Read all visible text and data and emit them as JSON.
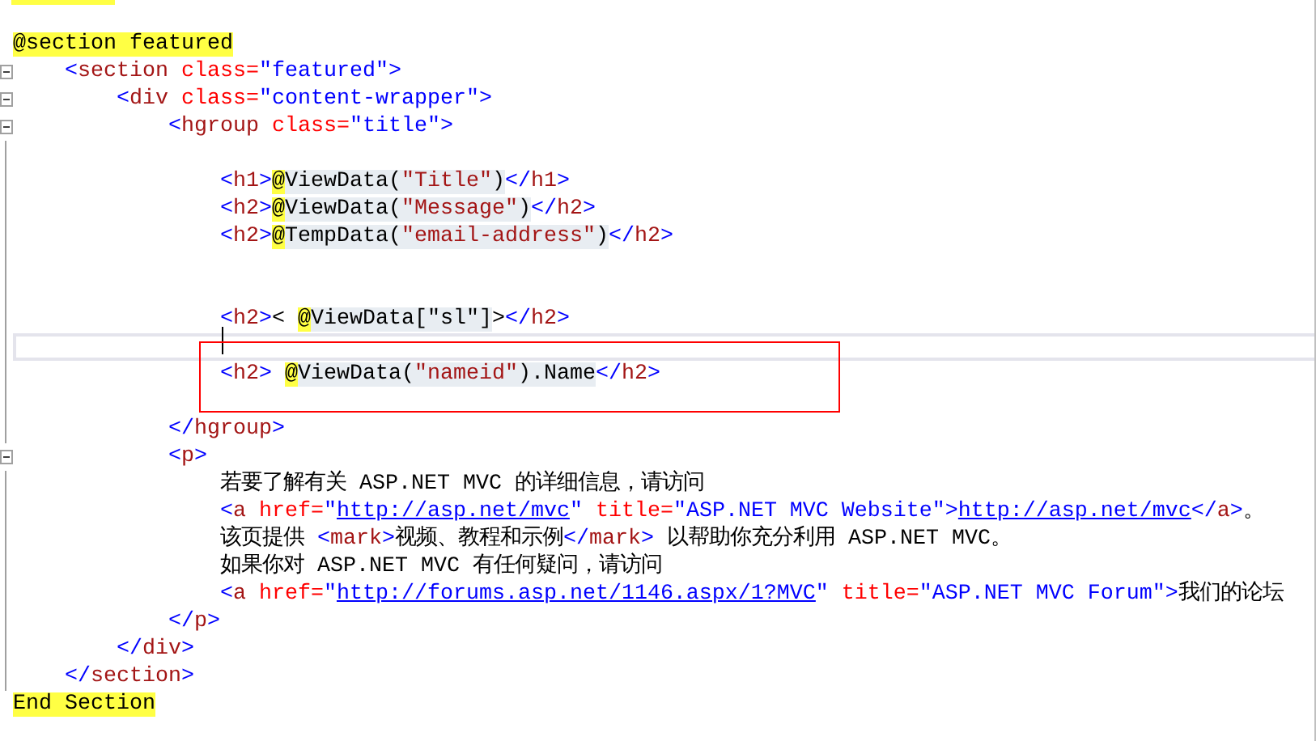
{
  "lines": [
    {
      "foldable": false,
      "nested": false,
      "current": false,
      "tokens": [
        {
          "kind": "directive",
          "text": "@section featured"
        }
      ]
    },
    {
      "foldable": true,
      "nested": true,
      "current": false,
      "tokens": [
        {
          "kind": "tag",
          "text": "    <"
        },
        {
          "kind": "name",
          "text": "section"
        },
        {
          "kind": "attr",
          "text": " class="
        },
        {
          "kind": "value",
          "text": "\"featured\""
        },
        {
          "kind": "tag",
          "text": ">"
        }
      ]
    },
    {
      "foldable": true,
      "nested": true,
      "current": false,
      "tokens": [
        {
          "kind": "tag",
          "text": "        <"
        },
        {
          "kind": "name",
          "text": "div"
        },
        {
          "kind": "attr",
          "text": " class="
        },
        {
          "kind": "value",
          "text": "\"content-wrapper\""
        },
        {
          "kind": "tag",
          "text": ">"
        }
      ]
    },
    {
      "foldable": true,
      "nested": true,
      "current": false,
      "tokens": [
        {
          "kind": "tag",
          "text": "            <"
        },
        {
          "kind": "name",
          "text": "hgroup"
        },
        {
          "kind": "attr",
          "text": " class="
        },
        {
          "kind": "value",
          "text": "\"title\""
        },
        {
          "kind": "tag",
          "text": ">"
        }
      ]
    },
    {
      "foldable": false,
      "nested": true,
      "current": false
    },
    {
      "foldable": false,
      "nested": true,
      "current": false,
      "tokens": [
        {
          "kind": "tag",
          "text": "                <"
        },
        {
          "kind": "name",
          "text": "h1"
        },
        {
          "kind": "tag",
          "text": ">"
        },
        {
          "kind": "at",
          "text": "@"
        },
        {
          "kind": "razor",
          "text": "ViewData("
        },
        {
          "kind": "rstring",
          "text": "\"Title\""
        },
        {
          "kind": "razor",
          "text": ")"
        },
        {
          "kind": "tag",
          "text": "</"
        },
        {
          "kind": "name",
          "text": "h1"
        },
        {
          "kind": "tag",
          "text": ">"
        }
      ]
    },
    {
      "foldable": false,
      "nested": true,
      "current": false,
      "tokens": [
        {
          "kind": "tag",
          "text": "                <"
        },
        {
          "kind": "name",
          "text": "h2"
        },
        {
          "kind": "tag",
          "text": ">"
        },
        {
          "kind": "at",
          "text": "@"
        },
        {
          "kind": "razor",
          "text": "ViewData("
        },
        {
          "kind": "rstring",
          "text": "\"Message\""
        },
        {
          "kind": "razor",
          "text": ")"
        },
        {
          "kind": "tag",
          "text": "</"
        },
        {
          "kind": "name",
          "text": "h2"
        },
        {
          "kind": "tag",
          "text": ">"
        }
      ]
    },
    {
      "foldable": false,
      "nested": true,
      "current": false,
      "tokens": [
        {
          "kind": "tag",
          "text": "                <"
        },
        {
          "kind": "name",
          "text": "h2"
        },
        {
          "kind": "tag",
          "text": ">"
        },
        {
          "kind": "at",
          "text": "@"
        },
        {
          "kind": "razor",
          "text": "TempData("
        },
        {
          "kind": "rstring",
          "text": "\"email-address\""
        },
        {
          "kind": "razor",
          "text": ")"
        },
        {
          "kind": "tag",
          "text": "</"
        },
        {
          "kind": "name",
          "text": "h2"
        },
        {
          "kind": "tag",
          "text": ">"
        }
      ]
    },
    {
      "foldable": false,
      "nested": true,
      "current": false
    },
    {
      "foldable": false,
      "nested": true,
      "current": false
    },
    {
      "foldable": false,
      "nested": true,
      "current": false,
      "tokens": [
        {
          "kind": "tag",
          "text": "                <"
        },
        {
          "kind": "name",
          "text": "h2"
        },
        {
          "kind": "tag",
          "text": ">"
        },
        {
          "kind": "text",
          "text": "< "
        },
        {
          "kind": "at",
          "text": "@"
        },
        {
          "kind": "razor",
          "text": "ViewData[\"sl\"]"
        },
        {
          "kind": "text",
          "text": ">"
        },
        {
          "kind": "tag",
          "text": "</"
        },
        {
          "kind": "name",
          "text": "h2"
        },
        {
          "kind": "tag",
          "text": ">"
        }
      ]
    },
    {
      "foldable": false,
      "nested": true,
      "current": true
    },
    {
      "foldable": false,
      "nested": true,
      "current": false,
      "tokens": [
        {
          "kind": "tag",
          "text": "                <"
        },
        {
          "kind": "name",
          "text": "h2"
        },
        {
          "kind": "tag",
          "text": "> "
        },
        {
          "kind": "at",
          "text": "@"
        },
        {
          "kind": "razor",
          "text": "ViewData("
        },
        {
          "kind": "rstring",
          "text": "\"nameid\""
        },
        {
          "kind": "razor",
          "text": ").Name"
        },
        {
          "kind": "tag",
          "text": "</"
        },
        {
          "kind": "name",
          "text": "h2"
        },
        {
          "kind": "tag",
          "text": ">"
        }
      ]
    },
    {
      "foldable": false,
      "nested": true,
      "current": false
    },
    {
      "foldable": false,
      "nested": true,
      "current": false,
      "tokens": [
        {
          "kind": "tag",
          "text": "            </"
        },
        {
          "kind": "name",
          "text": "hgroup"
        },
        {
          "kind": "tag",
          "text": ">"
        }
      ]
    },
    {
      "foldable": true,
      "nested": true,
      "current": false,
      "tokens": [
        {
          "kind": "tag",
          "text": "            <"
        },
        {
          "kind": "name",
          "text": "p"
        },
        {
          "kind": "tag",
          "text": ">"
        }
      ]
    },
    {
      "foldable": false,
      "nested": true,
      "current": false,
      "tokens": [
        {
          "kind": "text",
          "text": "                若要了解有关 ASP.NET MVC 的详细信息，请访问"
        }
      ]
    },
    {
      "foldable": false,
      "nested": true,
      "current": false,
      "tokens": [
        {
          "kind": "tag",
          "text": "                <"
        },
        {
          "kind": "name",
          "text": "a"
        },
        {
          "kind": "attr",
          "text": " href="
        },
        {
          "kind": "value",
          "text": "\""
        },
        {
          "kind": "link",
          "text": "http://asp.net/mvc"
        },
        {
          "kind": "value",
          "text": "\""
        },
        {
          "kind": "attr",
          "text": " title="
        },
        {
          "kind": "value",
          "text": "\"ASP.NET MVC Website\""
        },
        {
          "kind": "tag",
          "text": ">"
        },
        {
          "kind": "link",
          "text": "http://asp.net/mvc"
        },
        {
          "kind": "tag",
          "text": "</"
        },
        {
          "kind": "name",
          "text": "a"
        },
        {
          "kind": "tag",
          "text": ">"
        },
        {
          "kind": "text",
          "text": "。"
        }
      ]
    },
    {
      "foldable": false,
      "nested": true,
      "current": false,
      "tokens": [
        {
          "kind": "text",
          "text": "                该页提供 "
        },
        {
          "kind": "tag",
          "text": "<"
        },
        {
          "kind": "name",
          "text": "mark"
        },
        {
          "kind": "tag",
          "text": ">"
        },
        {
          "kind": "text",
          "text": "视频、教程和示例"
        },
        {
          "kind": "tag",
          "text": "</"
        },
        {
          "kind": "name",
          "text": "mark"
        },
        {
          "kind": "tag",
          "text": ">"
        },
        {
          "kind": "text",
          "text": " 以帮助你充分利用 ASP.NET MVC。"
        }
      ]
    },
    {
      "foldable": false,
      "nested": true,
      "current": false,
      "tokens": [
        {
          "kind": "text",
          "text": "                如果你对 ASP.NET MVC 有任何疑问，请访问"
        }
      ]
    },
    {
      "foldable": false,
      "nested": true,
      "current": false,
      "tokens": [
        {
          "kind": "tag",
          "text": "                <"
        },
        {
          "kind": "name",
          "text": "a"
        },
        {
          "kind": "attr",
          "text": " href="
        },
        {
          "kind": "value",
          "text": "\""
        },
        {
          "kind": "link",
          "text": "http://forums.asp.net/1146.aspx/1?MVC"
        },
        {
          "kind": "value",
          "text": "\""
        },
        {
          "kind": "attr",
          "text": " title="
        },
        {
          "kind": "value",
          "text": "\"ASP.NET MVC Forum\""
        },
        {
          "kind": "tag",
          "text": ">"
        },
        {
          "kind": "text",
          "text": "我们的论坛"
        }
      ]
    },
    {
      "foldable": false,
      "nested": true,
      "current": false,
      "tokens": [
        {
          "kind": "tag",
          "text": "            </"
        },
        {
          "kind": "name",
          "text": "p"
        },
        {
          "kind": "tag",
          "text": ">"
        }
      ]
    },
    {
      "foldable": false,
      "nested": true,
      "current": false,
      "tokens": [
        {
          "kind": "tag",
          "text": "        </"
        },
        {
          "kind": "name",
          "text": "div"
        },
        {
          "kind": "tag",
          "text": ">"
        }
      ]
    },
    {
      "foldable": false,
      "nested": true,
      "current": false,
      "tokens": [
        {
          "kind": "tag",
          "text": "    </"
        },
        {
          "kind": "name",
          "text": "section"
        },
        {
          "kind": "tag",
          "text": ">"
        }
      ]
    },
    {
      "foldable": false,
      "nested": false,
      "current": false,
      "tokens": [
        {
          "kind": "directive",
          "text": "End Section"
        }
      ]
    }
  ]
}
